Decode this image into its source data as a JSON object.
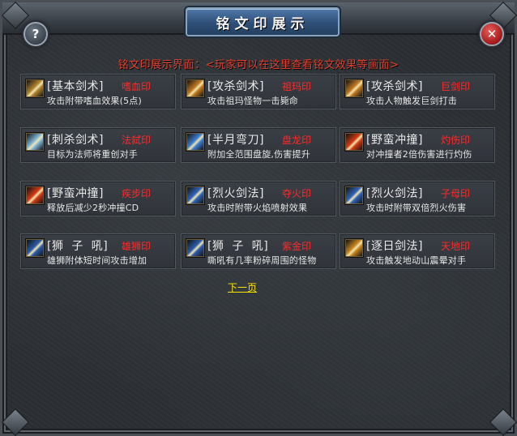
{
  "window": {
    "title": "铭文印展示",
    "subtitle": "铭文印展示界面：<玩家可以在这里查看铭文效果等画面>",
    "help_label": "?",
    "close_label": "✕"
  },
  "colors": {
    "skill_text": "#e9e9e9",
    "seal_text": "#ff2a2a",
    "subtitle_text": "#e8402e",
    "link_text": "#ffe800"
  },
  "cards": [
    {
      "skill": "[基本剑术]",
      "seal": "嗜血印",
      "desc": "攻击附带嗜血效果(5点)",
      "icon": "sword-icon",
      "icon_color": "#b0822e"
    },
    {
      "skill": "[攻杀剑术]",
      "seal": "祖玛印",
      "desc": "攻击祖玛怪物一击毙命",
      "icon": "slash-icon",
      "icon_color": "#c07a22"
    },
    {
      "skill": "[攻杀剑术]",
      "seal": "巨剑印",
      "desc": "攻击人物触发巨剑打击",
      "icon": "slash-icon",
      "icon_color": "#c07a22"
    },
    {
      "skill": "[刺杀剑术]",
      "seal": "法弑印",
      "desc": "目标为法师将重创对手",
      "icon": "thrust-icon",
      "icon_color": "#7fb6d6"
    },
    {
      "skill": "[半月弯刀]",
      "seal": "盘龙印",
      "desc": "附加全范围盘旋,伤害提升",
      "icon": "crescent-icon",
      "icon_color": "#3e7fd0"
    },
    {
      "skill": "[野蛮冲撞]",
      "seal": "灼伤印",
      "desc": "对冲撞者2倍伤害进行灼伤",
      "icon": "charge-icon",
      "icon_color": "#d23a12"
    },
    {
      "skill": "[野蛮冲撞]",
      "seal": "疾步印",
      "desc": "释放后减少2秒冲撞CD",
      "icon": "charge-icon",
      "icon_color": "#d23a12"
    },
    {
      "skill": "[烈火剑法]",
      "seal": "夺火印",
      "desc": "攻击时附带火焰喷射效果",
      "icon": "fire-sword-icon",
      "icon_color": "#2f64b8"
    },
    {
      "skill": "[烈火剑法]",
      "seal": "子母印",
      "desc": "攻击时附带双倍烈火伤害",
      "icon": "fire-sword-icon",
      "icon_color": "#2f64b8"
    },
    {
      "skill": "[狮  子  吼]",
      "seal": "雄狮印",
      "desc": "雄狮附体短时间攻击增加",
      "icon": "roar-icon",
      "icon_color": "#2c5aa8"
    },
    {
      "skill": "[狮  子  吼]",
      "seal": "紫金印",
      "desc": "嘶吼有几率粉碎周围的怪物",
      "icon": "roar-icon",
      "icon_color": "#2c5aa8"
    },
    {
      "skill": "[逐日剑法]",
      "seal": "天地印",
      "desc": "攻击触发地动山震晕对手",
      "icon": "sun-sword-icon",
      "icon_color": "#c7851f"
    }
  ],
  "footer": {
    "next_page": "下一页"
  }
}
